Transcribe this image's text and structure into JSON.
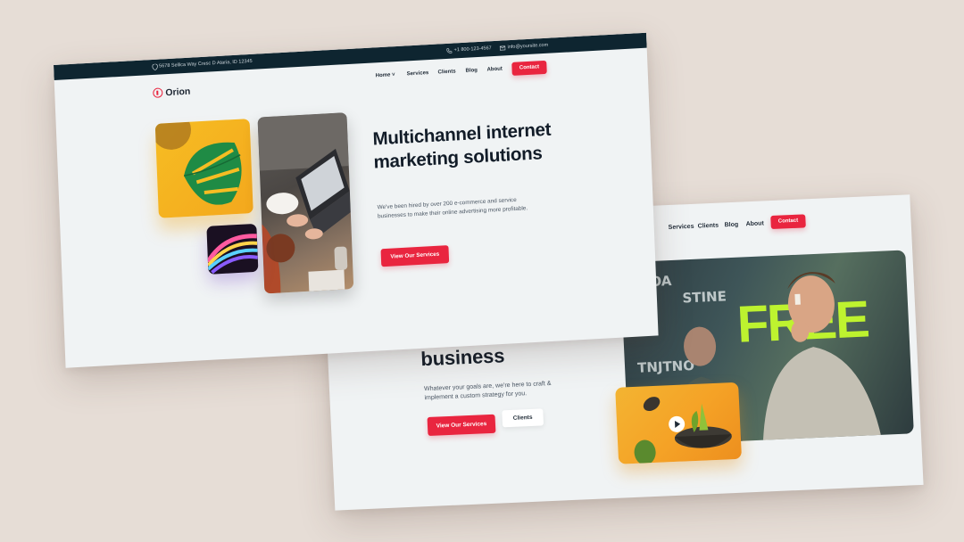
{
  "back_page": {
    "nav": [
      "Services",
      "Clients",
      "Blog",
      "About"
    ],
    "contact_label": "Contact",
    "heading_line": "business",
    "paragraph": "Whatever your goals are, we're here to craft & implement a custom strategy for you.",
    "primary_cta": "View Our Services",
    "secondary_cta": "Clients"
  },
  "front_page": {
    "topbar": {
      "address": "5678 Sellica Way Cresc D Ataria, ID 12345",
      "phone": "+1 800-123-4567",
      "email": "info@yoursite.com"
    },
    "brand": "Orion",
    "nav": {
      "home": "Home",
      "services": "Services",
      "clients": "Clients",
      "blog": "Blog",
      "about": "About",
      "contact": "Contact"
    },
    "hero": {
      "heading": "Multichannel internet marketing solutions",
      "paragraph": "We've been hired by over 200 e-commerce and service businesses to make their online advertising more profitable.",
      "cta": "View Our Services"
    }
  },
  "colors": {
    "accent": "#e9253f",
    "topbar": "#0e2530",
    "background": "#e6ddd6"
  }
}
